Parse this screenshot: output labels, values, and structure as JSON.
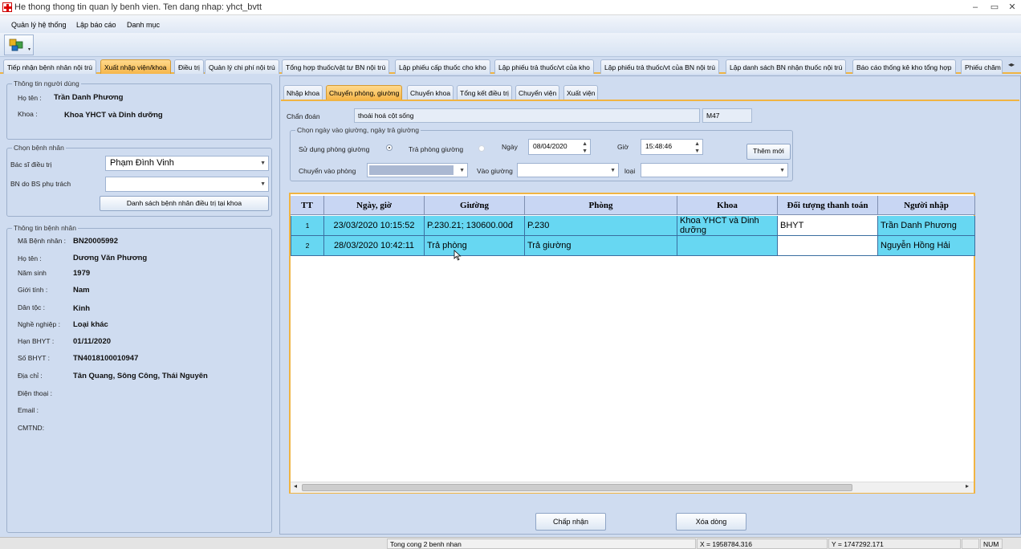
{
  "window": {
    "title": "He thong thong tin quan ly benh vien. Ten dang nhap: yhct_bvtt"
  },
  "menu": [
    "Quản lý hệ thống",
    "Lập báo cáo",
    "Danh mục"
  ],
  "main_tabs": [
    "Tiếp nhận bệnh nhân nội trú",
    "Xuất nhập viện/khoa",
    "Điều trị",
    "Quản lý chi phí nội trú",
    "Tổng hợp thuốc/vật tư BN nội trú",
    "Lập phiếu cấp thuốc cho kho",
    "Lập phiếu trả thuốc/vt của kho",
    "Lập phiếu trả thuốc/vt của BN nội trú",
    "Lập danh sách BN nhận thuốc nội trú",
    "Báo cáo thống kê kho tổng hợp",
    "Phiếu chăm"
  ],
  "user_info": {
    "group_title": "Thông tin người dùng",
    "name_label": "Họ tên :",
    "name": "Trần Danh Phương",
    "dept_label": "Khoa :",
    "dept": "Khoa YHCT và Dinh dưỡng"
  },
  "choose_patient": {
    "group_title": "Chọn bệnh nhân",
    "doctor_label": "Bác sĩ điều trị",
    "doctor": "Phạm Đình Vinh",
    "bn_label": "BN do BS phụ trách",
    "bn_value": "",
    "list_button": "Danh sách bệnh nhân điều trị tại khoa"
  },
  "patient_info": {
    "group_title": "Thông tin bệnh nhân",
    "fields": [
      {
        "label": "Mã Bệnh nhân :",
        "value": "BN20005992"
      },
      {
        "label": "Họ tên :",
        "value": "Dương Văn Phương"
      },
      {
        "label": "Năm sinh",
        "value": "1979"
      },
      {
        "label": "Giới tính :",
        "value": "Nam"
      },
      {
        "label": "Dân tộc :",
        "value": "Kinh"
      },
      {
        "label": "Nghề nghiệp :",
        "value": "Loại khác"
      },
      {
        "label": "Hạn BHYT :",
        "value": "01/11/2020"
      },
      {
        "label": "Số BHYT :",
        "value": "TN4018100010947"
      },
      {
        "label": "Địa chỉ :",
        "value": "Tân Quang, Sông Công, Thái Nguyên"
      },
      {
        "label": "Điện thoại :",
        "value": ""
      },
      {
        "label": "Email :",
        "value": ""
      },
      {
        "label": "CMTND:",
        "value": ""
      }
    ]
  },
  "sub_tabs": [
    "Nhập khoa",
    "Chuyển phòng, giường",
    "Chuyển khoa",
    "Tổng kết điều trị",
    "Chuyển viện",
    "Xuất viện"
  ],
  "form": {
    "diagnosis_label": "Chẩn đoán",
    "diagnosis": "thoái hoá cột sống",
    "diagnosis_code": "M47",
    "group_title": "Chọn ngày vào giường, ngày trả giường",
    "use_room_label": "Sử dụng phòng giường",
    "return_bed_label": "Trả phòng giường",
    "date_label": "Ngày",
    "date": "08/04/2020",
    "time_label": "Giờ",
    "time": "15:48:46",
    "add_new": "Thêm mới",
    "move_room_label": "Chuyển vào phòng",
    "move_room": "",
    "bed_label": "Vào giường",
    "bed": "",
    "type_label": "loại",
    "type": ""
  },
  "grid": {
    "columns": [
      "TT",
      "Ngày, giờ",
      "Giường",
      "Phòng",
      "Khoa",
      "Đối tượng thanh toán",
      "Người nhập"
    ],
    "rows": [
      {
        "tt": "1",
        "datetime": "23/03/2020 10:15:52",
        "bed": "P.230.21; 130600.00đ",
        "room": "P.230",
        "dept": "Khoa YHCT và Dinh dưỡng",
        "payer": "BHYT",
        "user": "Trần Danh Phương"
      },
      {
        "tt": "2",
        "datetime": "28/03/2020 10:42:11",
        "bed": "Trả phòng",
        "room": "Trả giường",
        "dept": "",
        "payer": "",
        "user": "Nguyễn Hồng Hải"
      }
    ]
  },
  "buttons": {
    "accept": "Chấp nhận",
    "delete_row": "Xóa dòng"
  },
  "status": {
    "summary": "Tong cong 2 benh nhan",
    "x": "X = 1958784.316",
    "y": "Y = 1747292.171",
    "num": "NUM"
  }
}
